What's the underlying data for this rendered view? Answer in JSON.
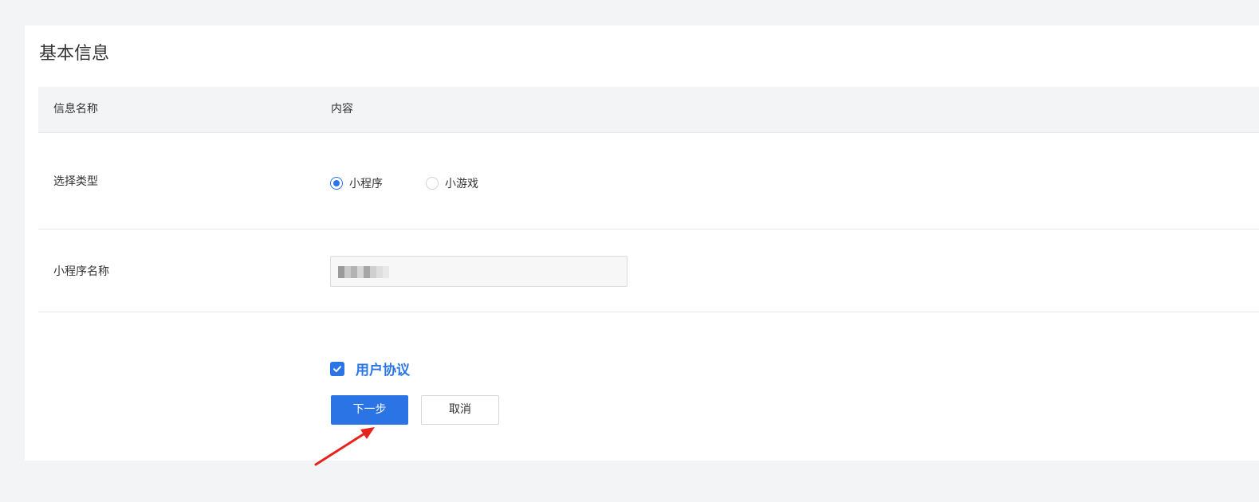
{
  "section": {
    "title": "基本信息"
  },
  "table": {
    "headers": [
      "信息名称",
      "内容"
    ]
  },
  "type_row": {
    "label": "选择类型",
    "options": [
      {
        "label": "小程序",
        "checked": true
      },
      {
        "label": "小游戏",
        "checked": false
      }
    ]
  },
  "name_row": {
    "label": "小程序名称",
    "value_obscured": true
  },
  "agreement": {
    "checked": true,
    "link_label": "用户协议"
  },
  "actions": {
    "next_label": "下一步",
    "cancel_label": "取消"
  },
  "colors": {
    "accent": "#2b74e6",
    "page_bg": "#f3f4f6",
    "header_bg": "#f3f4f6",
    "annotation_arrow": "#e8211c"
  },
  "icons": {
    "checkbox_mark": "checkmark-icon",
    "annotation": "red-arrow-icon"
  }
}
